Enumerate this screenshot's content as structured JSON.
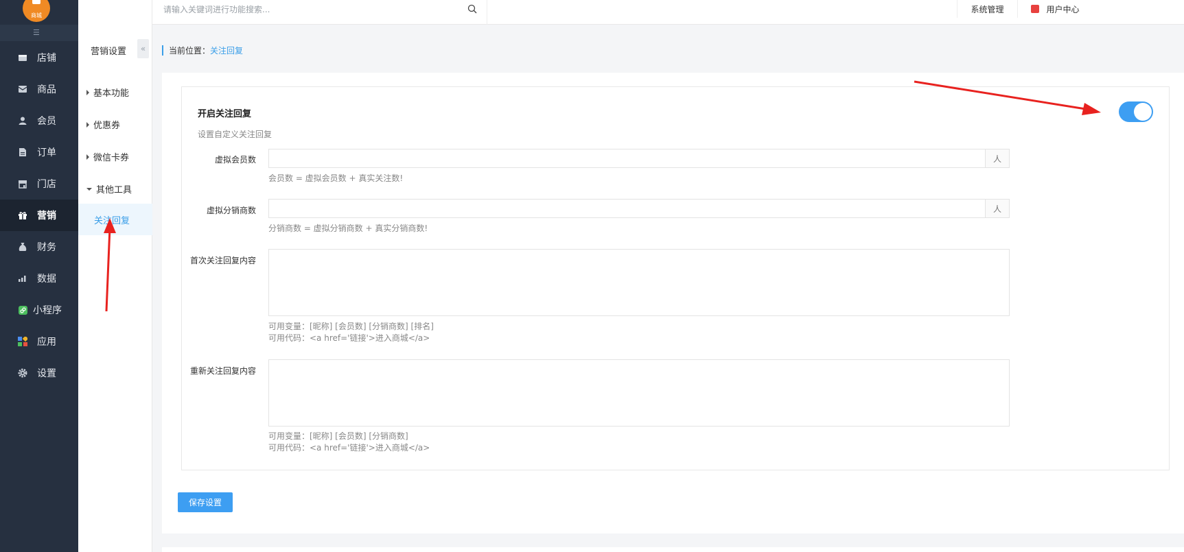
{
  "brand": {
    "logo_text": "商城"
  },
  "left_nav": [
    {
      "label": "店铺",
      "icon": "store-icon"
    },
    {
      "label": "商品",
      "icon": "goods-icon"
    },
    {
      "label": "会员",
      "icon": "member-icon"
    },
    {
      "label": "订单",
      "icon": "order-icon"
    },
    {
      "label": "门店",
      "icon": "shop-icon"
    },
    {
      "label": "营销",
      "icon": "gift-icon"
    },
    {
      "label": "财务",
      "icon": "money-bag-icon"
    },
    {
      "label": "数据",
      "icon": "chart-icon"
    },
    {
      "label": "小程序",
      "icon": "miniprogram-icon"
    },
    {
      "label": "应用",
      "icon": "apps-icon"
    },
    {
      "label": "设置",
      "icon": "gear-icon"
    }
  ],
  "left_nav_active": "营销",
  "sub_nav": {
    "title": "营销设置",
    "items": [
      "基本功能",
      "优惠券",
      "微信卡券",
      "其他工具"
    ],
    "active_child": "关注回复"
  },
  "topbar": {
    "search_placeholder": "请输入关键词进行功能搜索...",
    "system_label": "系统管理",
    "user_label": "用户中心"
  },
  "breadcrumb": {
    "prefix": "当前位置：",
    "current": "关注回复"
  },
  "form": {
    "title": "开启关注回复",
    "subtitle": "设置自定义关注回复",
    "toggle_on": true,
    "fields": {
      "virtual_members": {
        "label": "虚拟会员数",
        "value": "",
        "unit": "人",
        "help": "会员数 = 虚拟会员数 + 真实关注数!"
      },
      "virtual_distributors": {
        "label": "虚拟分销商数",
        "value": "",
        "unit": "人",
        "help": "分销商数 = 虚拟分销商数 + 真实分销商数!"
      },
      "first_reply": {
        "label": "首次关注回复内容",
        "value": "",
        "help1": "可用变量：[昵称] [会员数] [分销商数] [排名]",
        "help2": "可用代码：<a href='链接'>进入商城</a>"
      },
      "re_reply": {
        "label": "重新关注回复内容",
        "value": "",
        "help1": "可用变量：[昵称] [会员数] [分销商数]",
        "help2": "可用代码：<a href='链接'>进入商城</a>"
      }
    },
    "save_label": "保存设置"
  },
  "colors": {
    "accent": "#3d9ef2",
    "nav_bg": "#263040",
    "annotation_arrow": "#e8221f"
  }
}
